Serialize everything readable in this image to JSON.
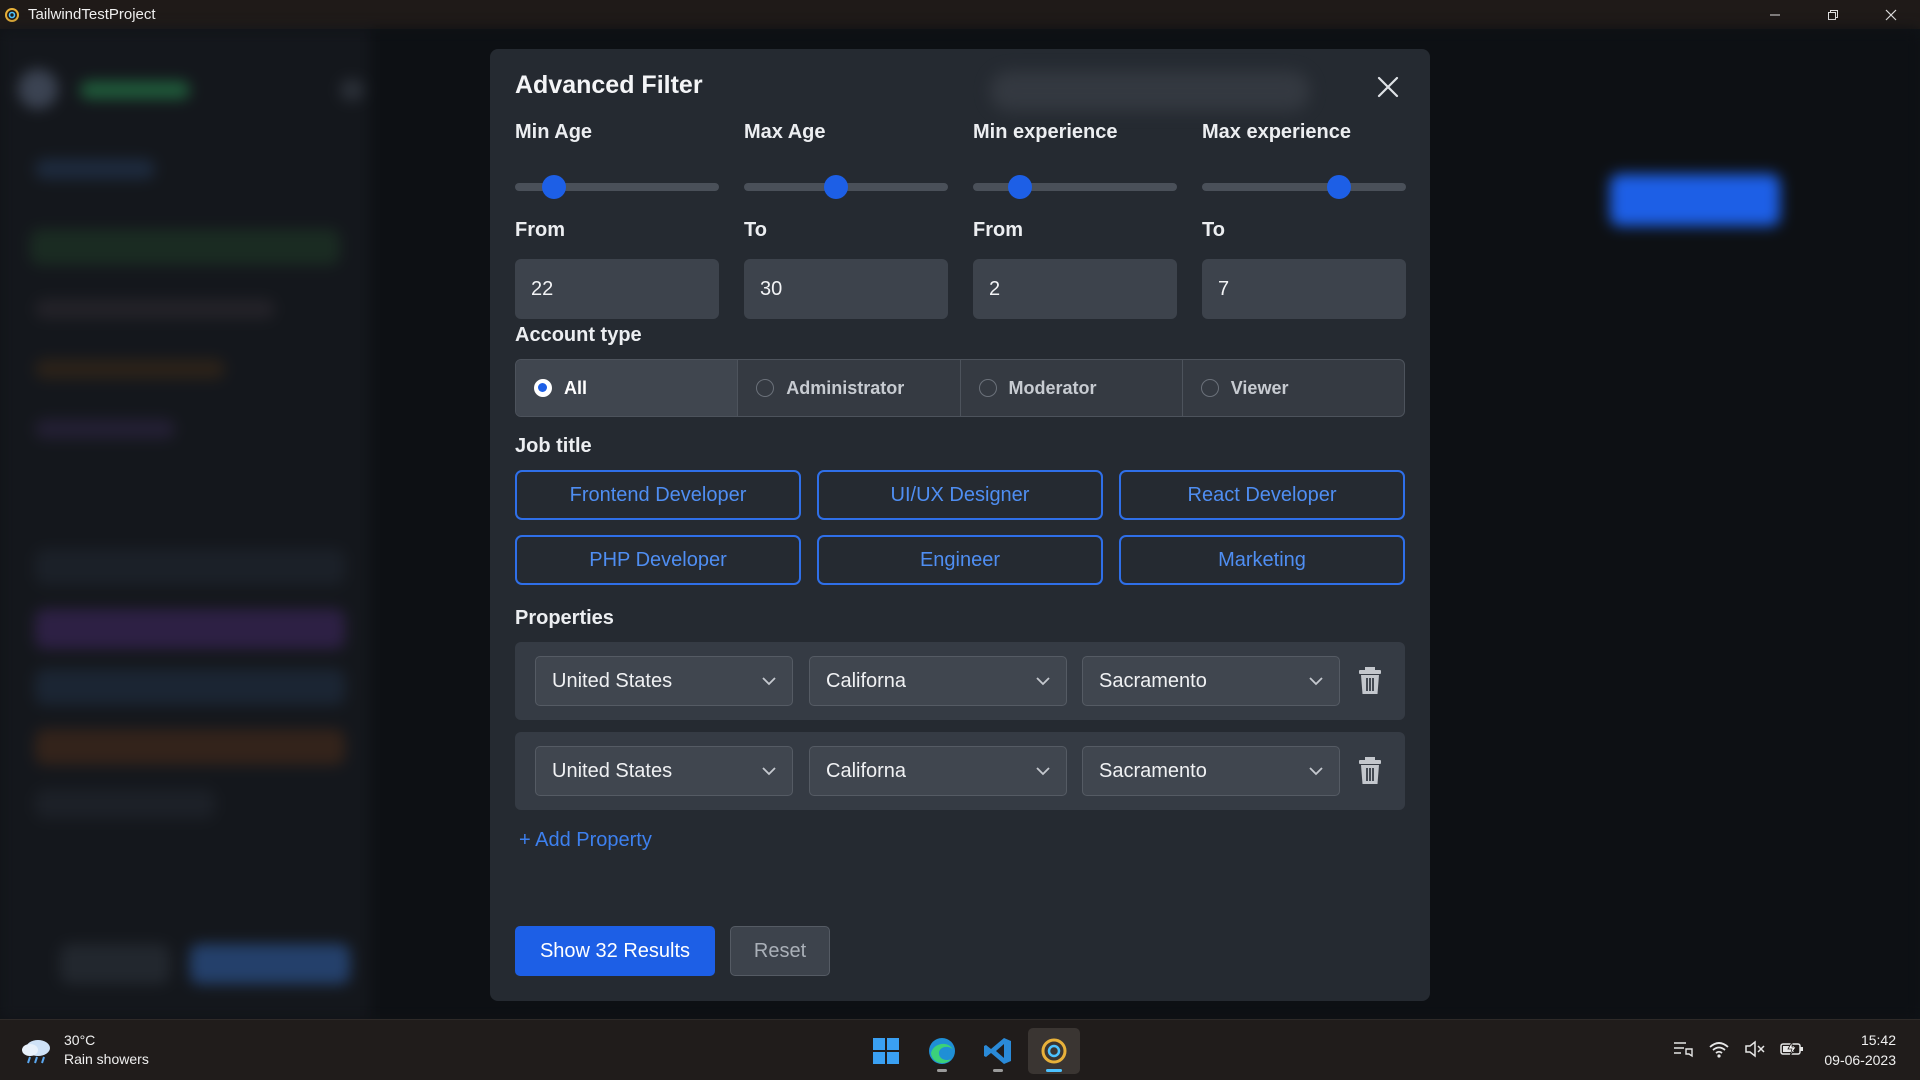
{
  "window": {
    "title": "TailwindTestProject",
    "controls": [
      "minimize",
      "restore",
      "close"
    ]
  },
  "modal": {
    "title": "Advanced Filter",
    "ranges": [
      {
        "label": "Min Age",
        "sub_label": "From",
        "value": "22",
        "slider_fraction": 0.19
      },
      {
        "label": "Max Age",
        "sub_label": "To",
        "value": "30",
        "slider_fraction": 0.45
      },
      {
        "label": "Min experience",
        "sub_label": "From",
        "value": "2",
        "slider_fraction": 0.23
      },
      {
        "label": "Max experience",
        "sub_label": "To",
        "value": "7",
        "slider_fraction": 0.67
      }
    ],
    "account_type": {
      "label": "Account type",
      "options": [
        "All",
        "Administrator",
        "Moderator",
        "Viewer"
      ],
      "selected": "All"
    },
    "job_title": {
      "label": "Job title",
      "options": [
        "Frontend Developer",
        "UI/UX Designer",
        "React Developer",
        "PHP Developer",
        "Engineer",
        "Marketing"
      ]
    },
    "properties": {
      "label": "Properties",
      "rows": [
        {
          "country": "United States",
          "state": "Californa",
          "city": "Sacramento"
        },
        {
          "country": "United States",
          "state": "Californa",
          "city": "Sacramento"
        }
      ],
      "add_label": "+ Add Property"
    },
    "actions": {
      "primary": "Show 32 Results",
      "reset": "Reset"
    }
  },
  "taskbar": {
    "weather": {
      "temp": "30°C",
      "condition": "Rain showers",
      "icon": "rain-cloud-icon"
    },
    "apps": [
      "windows-start-icon",
      "edge-browser-icon",
      "vscode-icon",
      "app-icon"
    ],
    "clock": {
      "time": "15:42",
      "date": "09-06-2023"
    }
  },
  "colors": {
    "accent": "#1d5fe6",
    "modal_bg": "#252a31",
    "job_border": "#2f6fe8"
  }
}
